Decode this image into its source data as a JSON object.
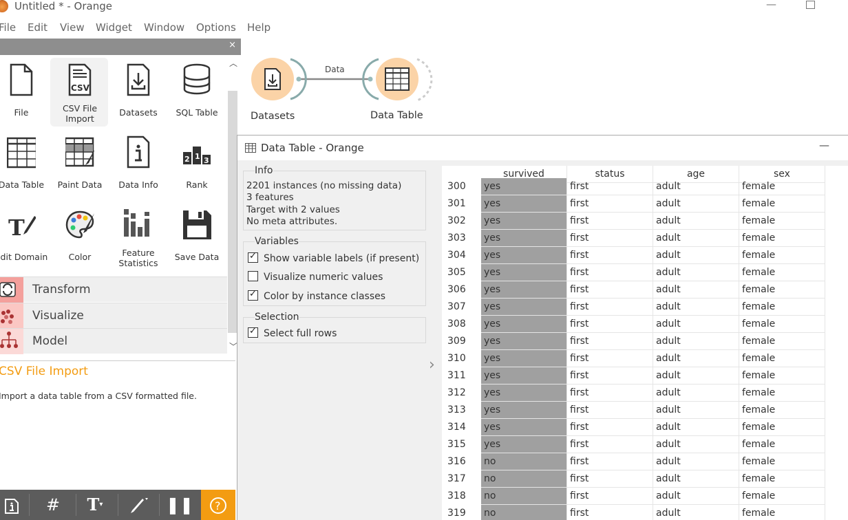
{
  "window": {
    "title": "Untitled * - Orange"
  },
  "menu": [
    "File",
    "Edit",
    "View",
    "Widget",
    "Window",
    "Options",
    "Help"
  ],
  "widgets": [
    {
      "label": "File",
      "icon": "file-icon"
    },
    {
      "label": "CSV File Import",
      "icon": "csv-icon",
      "selected": true
    },
    {
      "label": "Datasets",
      "icon": "datasets-icon"
    },
    {
      "label": "SQL Table",
      "icon": "database-icon"
    },
    {
      "label": "Data Table",
      "icon": "table-icon"
    },
    {
      "label": "Paint Data",
      "icon": "paint-data-icon"
    },
    {
      "label": "Data Info",
      "icon": "info-icon"
    },
    {
      "label": "Rank",
      "icon": "rank-icon"
    },
    {
      "label": "Edit Domain",
      "icon": "edit-domain-icon"
    },
    {
      "label": "Color",
      "icon": "palette-icon"
    },
    {
      "label": "Feature Statistics",
      "icon": "bar-chart-icon"
    },
    {
      "label": "Save Data",
      "icon": "save-icon"
    }
  ],
  "categories": [
    "Transform",
    "Visualize",
    "Model"
  ],
  "description": {
    "title": "CSV File Import",
    "text": "Import a data table from a CSV formatted file."
  },
  "canvas": {
    "nodes": [
      {
        "label": "Datasets"
      },
      {
        "label": "Data Table"
      }
    ],
    "link_label": "Data"
  },
  "data_table_window": {
    "title": "Data Table - Orange",
    "info": {
      "title": "Info",
      "lines": [
        "2201 instances (no missing data)",
        "3  features",
        "Target with 2 values",
        "No meta attributes."
      ]
    },
    "variables": {
      "title": "Variables",
      "options": [
        {
          "label": "Show variable labels (if present)",
          "checked": true
        },
        {
          "label": "Visualize numeric values",
          "checked": false
        },
        {
          "label": "Color by instance classes",
          "checked": true
        }
      ]
    },
    "selection": {
      "title": "Selection",
      "options": [
        {
          "label": "Select full rows",
          "checked": true
        }
      ]
    },
    "table": {
      "columns": [
        "survived",
        "status",
        "age",
        "sex"
      ],
      "rows": [
        [
          "300",
          "yes",
          "first",
          "adult",
          "female"
        ],
        [
          "301",
          "yes",
          "first",
          "adult",
          "female"
        ],
        [
          "302",
          "yes",
          "first",
          "adult",
          "female"
        ],
        [
          "303",
          "yes",
          "first",
          "adult",
          "female"
        ],
        [
          "304",
          "yes",
          "first",
          "adult",
          "female"
        ],
        [
          "305",
          "yes",
          "first",
          "adult",
          "female"
        ],
        [
          "306",
          "yes",
          "first",
          "adult",
          "female"
        ],
        [
          "307",
          "yes",
          "first",
          "adult",
          "female"
        ],
        [
          "308",
          "yes",
          "first",
          "adult",
          "female"
        ],
        [
          "309",
          "yes",
          "first",
          "adult",
          "female"
        ],
        [
          "310",
          "yes",
          "first",
          "adult",
          "female"
        ],
        [
          "311",
          "yes",
          "first",
          "adult",
          "female"
        ],
        [
          "312",
          "yes",
          "first",
          "adult",
          "female"
        ],
        [
          "313",
          "yes",
          "first",
          "adult",
          "female"
        ],
        [
          "314",
          "yes",
          "first",
          "adult",
          "female"
        ],
        [
          "315",
          "yes",
          "first",
          "adult",
          "female"
        ],
        [
          "316",
          "no",
          "first",
          "adult",
          "female"
        ],
        [
          "317",
          "no",
          "first",
          "adult",
          "female"
        ],
        [
          "318",
          "no",
          "first",
          "adult",
          "female"
        ],
        [
          "319",
          "no",
          "first",
          "adult",
          "female"
        ]
      ]
    }
  },
  "colors": {
    "accent": "#f39c12",
    "node": "#fbd3a7",
    "class_cell": "#a0a0a0"
  }
}
